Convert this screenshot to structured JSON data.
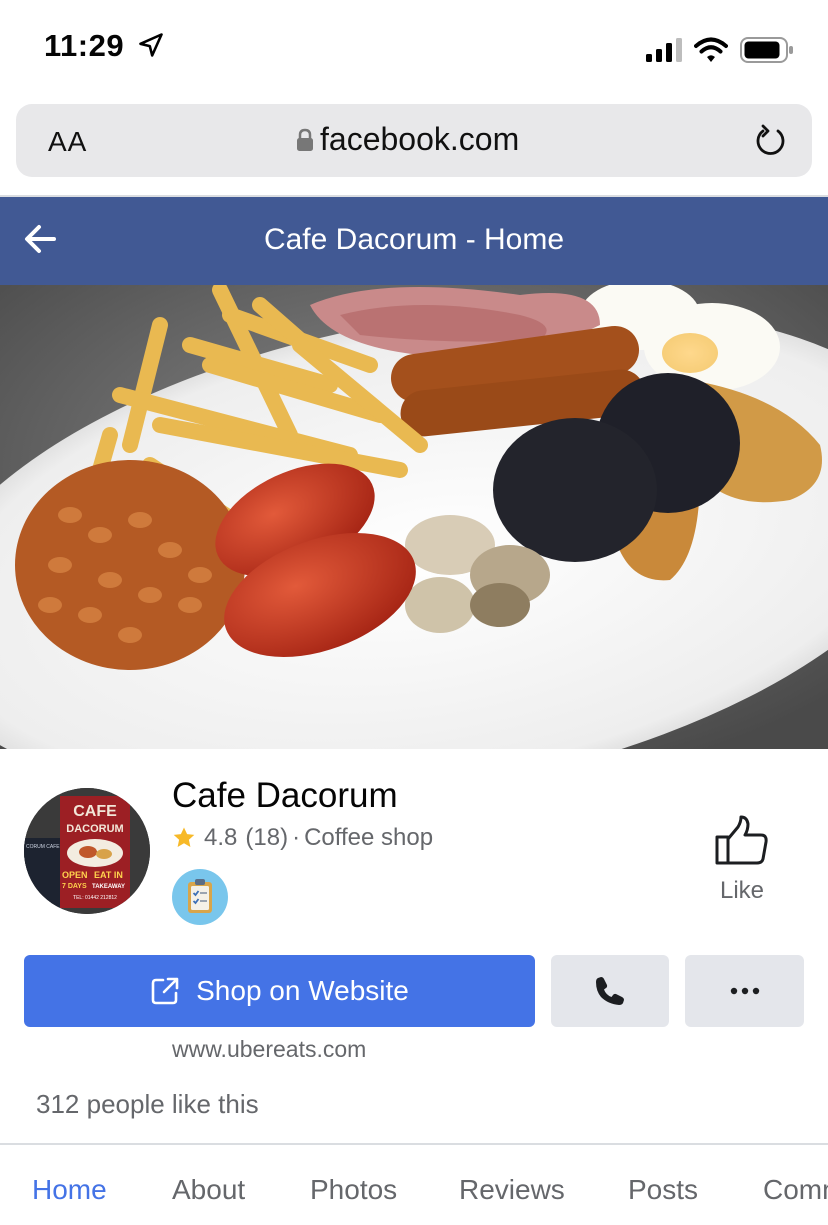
{
  "status_bar": {
    "time": "11:29"
  },
  "address_bar": {
    "text_size_label": "AA",
    "url": "facebook.com"
  },
  "header": {
    "title": "Cafe Dacorum - Home"
  },
  "page": {
    "name": "Cafe Dacorum",
    "rating": "4.8",
    "review_count": "(18)",
    "separator": "·",
    "category": "Coffee shop",
    "like_label": "Like",
    "website_host": "www.ubereats.com",
    "likes_text": "312 people like this"
  },
  "avatar_sign": {
    "line1": "CAFE",
    "line2": "DACORUM",
    "open": "OPEN",
    "days": "7 DAYS",
    "eat_in": "EAT IN",
    "takeaway": "TAKEAWAY",
    "tel": "TEL: 01442 212812",
    "side": "CORUM CAFE"
  },
  "actions": {
    "shop_label": "Shop on Website"
  },
  "tabs": [
    {
      "label": "Home",
      "active": true
    },
    {
      "label": "About"
    },
    {
      "label": "Photos"
    },
    {
      "label": "Reviews"
    },
    {
      "label": "Posts"
    },
    {
      "label": "Comm"
    }
  ],
  "colors": {
    "fb_header": "#415994",
    "primary_button": "#4473e6",
    "active_tab": "#4473e6",
    "secondary_text": "#65676b",
    "star": "#f7b928"
  },
  "icons": [
    "location-arrow-icon",
    "signal-icon",
    "wifi-icon",
    "battery-icon",
    "lock-icon",
    "reload-icon",
    "back-arrow-icon",
    "star-icon",
    "clipboard-badge-icon",
    "thumbs-up-icon",
    "external-link-icon",
    "phone-icon",
    "more-icon"
  ]
}
